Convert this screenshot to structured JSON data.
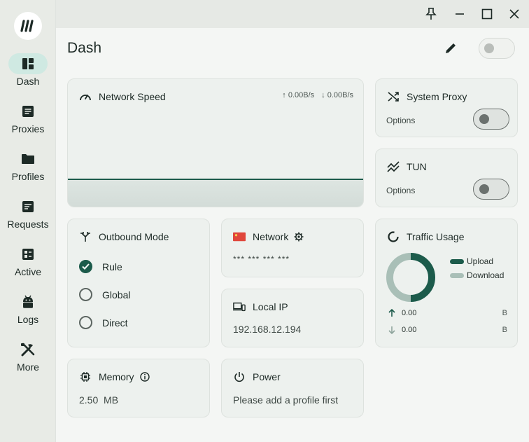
{
  "nav": [
    {
      "label": "Dash",
      "icon": "dashboard-icon"
    },
    {
      "label": "Proxies",
      "icon": "proxies-icon"
    },
    {
      "label": "Profiles",
      "icon": "folder-icon"
    },
    {
      "label": "Requests",
      "icon": "requests-icon"
    },
    {
      "label": "Active",
      "icon": "active-icon"
    },
    {
      "label": "Logs",
      "icon": "android-icon"
    },
    {
      "label": "More",
      "icon": "tools-icon"
    }
  ],
  "page": {
    "title": "Dash"
  },
  "network_speed": {
    "title": "Network Speed",
    "up": "↑ 0.00B/s",
    "down": "↓ 0.00B/s"
  },
  "system_proxy": {
    "title": "System Proxy",
    "options_label": "Options",
    "enabled": false
  },
  "tun": {
    "title": "TUN",
    "options_label": "Options",
    "enabled": false
  },
  "outbound": {
    "title": "Outbound Mode",
    "modes": [
      {
        "label": "Rule",
        "selected": true
      },
      {
        "label": "Global",
        "selected": false
      },
      {
        "label": "Direct",
        "selected": false
      }
    ]
  },
  "network": {
    "title": "Network",
    "value": "*** *** *** ***"
  },
  "local_ip": {
    "title": "Local IP",
    "value": "192.168.12.194"
  },
  "traffic": {
    "title": "Traffic Usage",
    "legend_upload": "Upload",
    "legend_download": "Download",
    "upload_value": "0.00",
    "download_value": "0.00",
    "unit": "B",
    "upload_color": "#1c5b4b",
    "download_color": "#a9bfb7"
  },
  "memory": {
    "title": "Memory",
    "value": "2.50  MB"
  },
  "power": {
    "title": "Power",
    "value": "Please add a profile first"
  },
  "colors": {
    "accent": "#1c5b4b",
    "accent_light": "#cfe9e2"
  }
}
